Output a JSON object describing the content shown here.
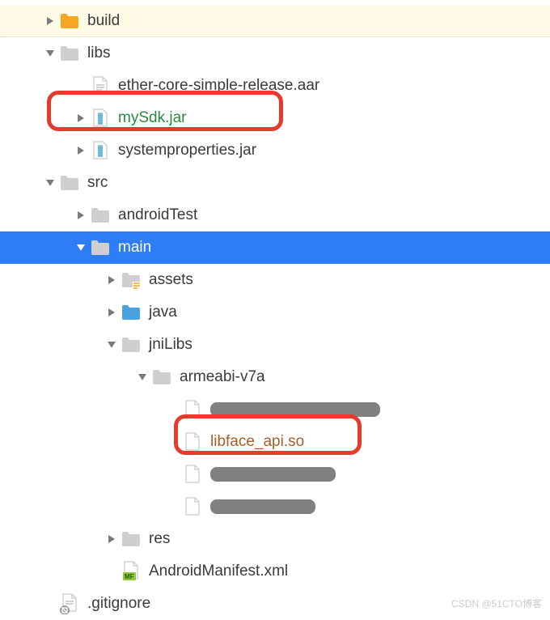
{
  "colors": {
    "selection": "#2f7df6",
    "highlight_border": "#e43b2d",
    "folder_gray": "#c8c8c8",
    "folder_orange": "#f5a623",
    "folder_blue": "#4aa3df",
    "arrow": "#7b7b7b",
    "arrow_selected": "#ffffff",
    "jar_green": "#2b8a3e",
    "so_brown": "#a85d27"
  },
  "tree": {
    "build": {
      "label": "build"
    },
    "libs": {
      "label": "libs",
      "children": {
        "aar": {
          "label": "ether-core-simple-release.aar"
        },
        "mysdk": {
          "label": "mySdk.jar"
        },
        "sysprops": {
          "label": "systemproperties.jar"
        }
      }
    },
    "src": {
      "label": "src",
      "children": {
        "androidTest": {
          "label": "androidTest"
        },
        "main": {
          "label": "main",
          "children": {
            "assets": {
              "label": "assets"
            },
            "java": {
              "label": "java"
            },
            "jniLibs": {
              "label": "jniLibs",
              "children": {
                "armeabi_v7a": {
                  "label": "armeabi-v7a",
                  "children": {
                    "file1": {
                      "label": ""
                    },
                    "libface": {
                      "label": "libface_api.so"
                    },
                    "file3": {
                      "label": ""
                    },
                    "file4": {
                      "label": ""
                    }
                  }
                }
              }
            },
            "res": {
              "label": "res"
            },
            "manifest": {
              "label": "AndroidManifest.xml"
            }
          }
        }
      }
    },
    "gitignore": {
      "label": ".gitignore"
    }
  },
  "watermark": "CSDN @51CTO博客"
}
